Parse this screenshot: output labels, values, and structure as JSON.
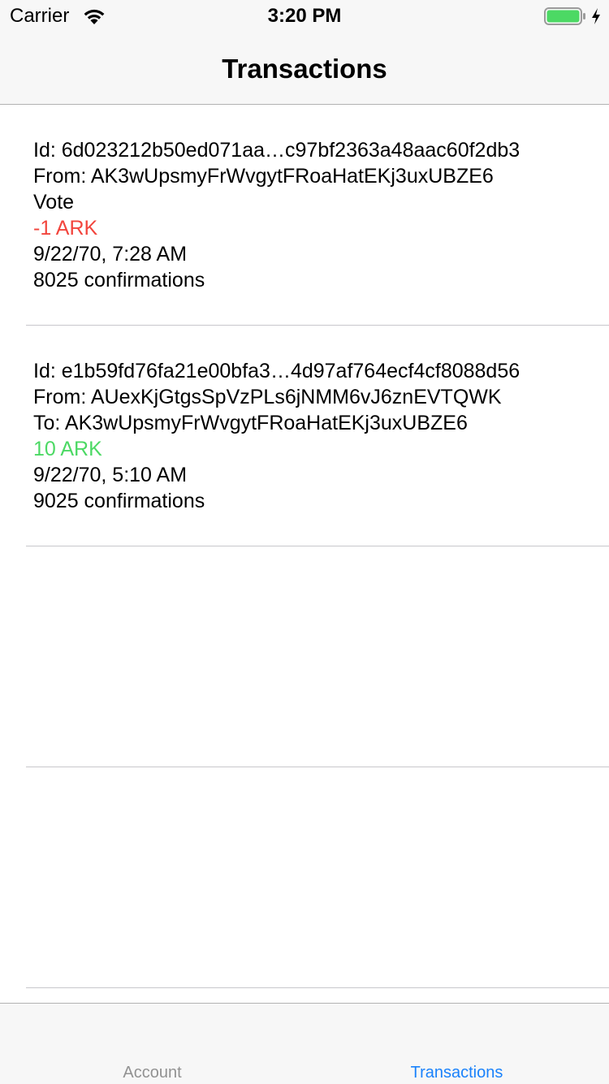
{
  "status_bar": {
    "carrier": "Carrier",
    "time": "3:20 PM",
    "wifi_icon": "wifi-icon",
    "battery_icon": "battery-icon",
    "charging_icon": "charging-bolt-icon",
    "battery_color": "#4cd964"
  },
  "nav": {
    "title": "Transactions"
  },
  "transactions": [
    {
      "id": "Id: 6d023212b50ed071aa…c97bf2363a48aac60f2db3",
      "from": "From: AK3wUpsmyFrWvgytFRoaHatEKj3uxUBZE6",
      "detail": "Vote",
      "amount": "-1 ARK",
      "amount_color": "#f2453d",
      "date": "9/22/70, 7:28 AM",
      "confirmations": "8025 confirmations"
    },
    {
      "id": "Id: e1b59fd76fa21e00bfa3…4d97af764ecf4cf8088d56",
      "from": "From: AUexKjGtgsSpVzPLs6jNMM6vJ6znEVTQWK",
      "detail": "To: AK3wUpsmyFrWvgytFRoaHatEKj3uxUBZE6",
      "amount": "10 ARK",
      "amount_color": "#4cd964",
      "date": "9/22/70, 5:10 AM",
      "confirmations": "9025 confirmations"
    }
  ],
  "tab_bar": {
    "tabs": [
      {
        "label": "Account",
        "active": false
      },
      {
        "label": "Transactions",
        "active": true
      }
    ],
    "active_color": "#1a82fb",
    "inactive_color": "#929292"
  }
}
